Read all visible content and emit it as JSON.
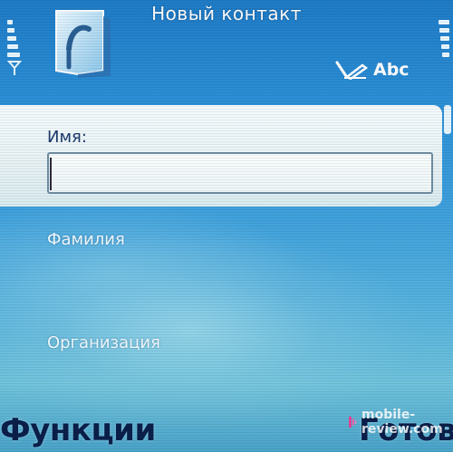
{
  "status_bar": {
    "title": "Новый контакт",
    "signal_icon": "antenna-icon",
    "input_mode_icon": "pen-icon",
    "input_mode": "Abc"
  },
  "form": {
    "fields": [
      {
        "label": "Имя:",
        "value": ""
      },
      {
        "label": "Фамилия"
      },
      {
        "label": "Организация"
      }
    ]
  },
  "softkeys": {
    "left": "Функции",
    "right": "Готово"
  },
  "watermark": {
    "text": "mobile-review.com"
  },
  "colors": {
    "background_top": "#1f7cc7",
    "background_bottom": "#6fc3dc",
    "softkey_text": "#0a1f4a",
    "label_dark": "#1d3a6d"
  }
}
